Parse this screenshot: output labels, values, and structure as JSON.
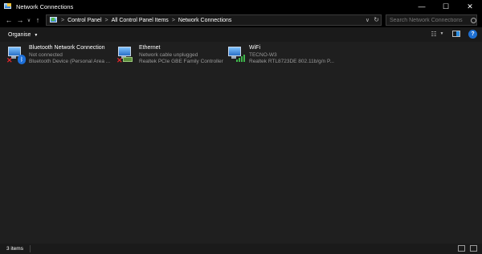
{
  "window": {
    "title": "Network Connections",
    "controls": {
      "minimize": "—",
      "maximize": "☐",
      "close": "✕"
    }
  },
  "address": {
    "breadcrumbs": [
      "Control Panel",
      "All Control Panel Items",
      "Network Connections"
    ],
    "separator": ">"
  },
  "search": {
    "placeholder": "Search Network Connections"
  },
  "toolbar": {
    "organise_label": "Organise"
  },
  "connections": [
    {
      "name": "Bluetooth Network Connection",
      "status": "Not connected",
      "device": "Bluetooth Device (Personal Area ..."
    },
    {
      "name": "Ethernet",
      "status": "Network cable unplugged",
      "device": "Realtek PCIe GBE Family Controller"
    },
    {
      "name": "WiFi",
      "status": "TECNO-W3",
      "device": "Realtek RTL8723DE 802.11b/g/n P..."
    }
  ],
  "status_bar": {
    "item_count": "3 items"
  },
  "colors": {
    "accent": "#1e6fd1",
    "error": "#e0262b",
    "signal": "#3eb44a"
  },
  "icons": {
    "bluetooth": "bluetooth-icon",
    "ethernet": "ethernet-icon",
    "wifi": "wifi-icon",
    "disconnected": "red-x-icon"
  }
}
